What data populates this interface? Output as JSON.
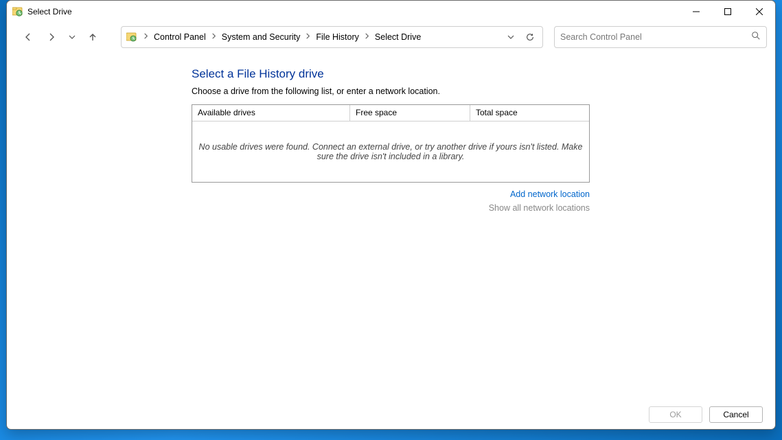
{
  "window": {
    "title": "Select Drive"
  },
  "breadcrumb": {
    "items": [
      "Control Panel",
      "System and Security",
      "File History",
      "Select Drive"
    ]
  },
  "search": {
    "placeholder": "Search Control Panel"
  },
  "page": {
    "heading": "Select a File History drive",
    "subtext": "Choose a drive from the following list, or enter a network location."
  },
  "table": {
    "headers": {
      "available": "Available drives",
      "free": "Free space",
      "total": "Total space"
    },
    "empty_message": "No usable drives were found. Connect an external drive, or try another drive if yours isn't listed. Make sure the drive isn't included in a library."
  },
  "links": {
    "add_network": "Add network location",
    "show_all": "Show all network locations"
  },
  "buttons": {
    "ok": "OK",
    "cancel": "Cancel"
  }
}
